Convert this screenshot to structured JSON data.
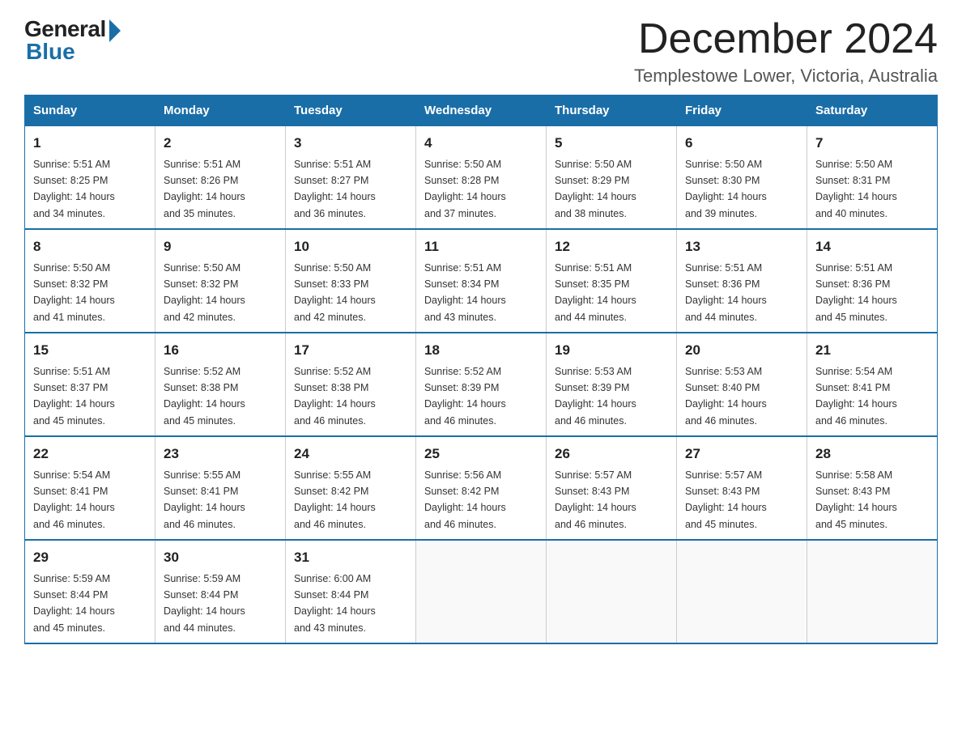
{
  "header": {
    "logo_general": "General",
    "logo_blue": "Blue",
    "month_title": "December 2024",
    "location": "Templestowe Lower, Victoria, Australia"
  },
  "days_of_week": [
    "Sunday",
    "Monday",
    "Tuesday",
    "Wednesday",
    "Thursday",
    "Friday",
    "Saturday"
  ],
  "weeks": [
    [
      {
        "day": "1",
        "sunrise": "5:51 AM",
        "sunset": "8:25 PM",
        "daylight": "14 hours and 34 minutes."
      },
      {
        "day": "2",
        "sunrise": "5:51 AM",
        "sunset": "8:26 PM",
        "daylight": "14 hours and 35 minutes."
      },
      {
        "day": "3",
        "sunrise": "5:51 AM",
        "sunset": "8:27 PM",
        "daylight": "14 hours and 36 minutes."
      },
      {
        "day": "4",
        "sunrise": "5:50 AM",
        "sunset": "8:28 PM",
        "daylight": "14 hours and 37 minutes."
      },
      {
        "day": "5",
        "sunrise": "5:50 AM",
        "sunset": "8:29 PM",
        "daylight": "14 hours and 38 minutes."
      },
      {
        "day": "6",
        "sunrise": "5:50 AM",
        "sunset": "8:30 PM",
        "daylight": "14 hours and 39 minutes."
      },
      {
        "day": "7",
        "sunrise": "5:50 AM",
        "sunset": "8:31 PM",
        "daylight": "14 hours and 40 minutes."
      }
    ],
    [
      {
        "day": "8",
        "sunrise": "5:50 AM",
        "sunset": "8:32 PM",
        "daylight": "14 hours and 41 minutes."
      },
      {
        "day": "9",
        "sunrise": "5:50 AM",
        "sunset": "8:32 PM",
        "daylight": "14 hours and 42 minutes."
      },
      {
        "day": "10",
        "sunrise": "5:50 AM",
        "sunset": "8:33 PM",
        "daylight": "14 hours and 42 minutes."
      },
      {
        "day": "11",
        "sunrise": "5:51 AM",
        "sunset": "8:34 PM",
        "daylight": "14 hours and 43 minutes."
      },
      {
        "day": "12",
        "sunrise": "5:51 AM",
        "sunset": "8:35 PM",
        "daylight": "14 hours and 44 minutes."
      },
      {
        "day": "13",
        "sunrise": "5:51 AM",
        "sunset": "8:36 PM",
        "daylight": "14 hours and 44 minutes."
      },
      {
        "day": "14",
        "sunrise": "5:51 AM",
        "sunset": "8:36 PM",
        "daylight": "14 hours and 45 minutes."
      }
    ],
    [
      {
        "day": "15",
        "sunrise": "5:51 AM",
        "sunset": "8:37 PM",
        "daylight": "14 hours and 45 minutes."
      },
      {
        "day": "16",
        "sunrise": "5:52 AM",
        "sunset": "8:38 PM",
        "daylight": "14 hours and 45 minutes."
      },
      {
        "day": "17",
        "sunrise": "5:52 AM",
        "sunset": "8:38 PM",
        "daylight": "14 hours and 46 minutes."
      },
      {
        "day": "18",
        "sunrise": "5:52 AM",
        "sunset": "8:39 PM",
        "daylight": "14 hours and 46 minutes."
      },
      {
        "day": "19",
        "sunrise": "5:53 AM",
        "sunset": "8:39 PM",
        "daylight": "14 hours and 46 minutes."
      },
      {
        "day": "20",
        "sunrise": "5:53 AM",
        "sunset": "8:40 PM",
        "daylight": "14 hours and 46 minutes."
      },
      {
        "day": "21",
        "sunrise": "5:54 AM",
        "sunset": "8:41 PM",
        "daylight": "14 hours and 46 minutes."
      }
    ],
    [
      {
        "day": "22",
        "sunrise": "5:54 AM",
        "sunset": "8:41 PM",
        "daylight": "14 hours and 46 minutes."
      },
      {
        "day": "23",
        "sunrise": "5:55 AM",
        "sunset": "8:41 PM",
        "daylight": "14 hours and 46 minutes."
      },
      {
        "day": "24",
        "sunrise": "5:55 AM",
        "sunset": "8:42 PM",
        "daylight": "14 hours and 46 minutes."
      },
      {
        "day": "25",
        "sunrise": "5:56 AM",
        "sunset": "8:42 PM",
        "daylight": "14 hours and 46 minutes."
      },
      {
        "day": "26",
        "sunrise": "5:57 AM",
        "sunset": "8:43 PM",
        "daylight": "14 hours and 46 minutes."
      },
      {
        "day": "27",
        "sunrise": "5:57 AM",
        "sunset": "8:43 PM",
        "daylight": "14 hours and 45 minutes."
      },
      {
        "day": "28",
        "sunrise": "5:58 AM",
        "sunset": "8:43 PM",
        "daylight": "14 hours and 45 minutes."
      }
    ],
    [
      {
        "day": "29",
        "sunrise": "5:59 AM",
        "sunset": "8:44 PM",
        "daylight": "14 hours and 45 minutes."
      },
      {
        "day": "30",
        "sunrise": "5:59 AM",
        "sunset": "8:44 PM",
        "daylight": "14 hours and 44 minutes."
      },
      {
        "day": "31",
        "sunrise": "6:00 AM",
        "sunset": "8:44 PM",
        "daylight": "14 hours and 43 minutes."
      },
      null,
      null,
      null,
      null
    ]
  ],
  "labels": {
    "sunrise": "Sunrise:",
    "sunset": "Sunset:",
    "daylight": "Daylight:"
  }
}
